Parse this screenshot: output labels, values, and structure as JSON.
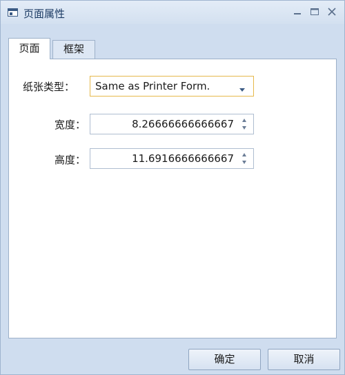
{
  "window": {
    "title": "页面属性",
    "icon": "dialog-window-icon",
    "controls": [
      "minimize-icon",
      "maximize-icon",
      "close-icon"
    ]
  },
  "tabs": [
    {
      "label": "页面",
      "active": true
    },
    {
      "label": "框架",
      "active": false
    }
  ],
  "form": {
    "paper_type": {
      "label": "纸张类型：",
      "value": "Same as Printer Form."
    },
    "width": {
      "label": "宽度：",
      "value": "8.26666666666667"
    },
    "height": {
      "label": "高度：",
      "value": "11.6916666666667"
    }
  },
  "buttons": {
    "ok": "确定",
    "cancel": "取消"
  },
  "colors": {
    "chrome_blue": "#cfddef",
    "focus_border": "#e6b84a",
    "title_text": "#1b3a63"
  }
}
